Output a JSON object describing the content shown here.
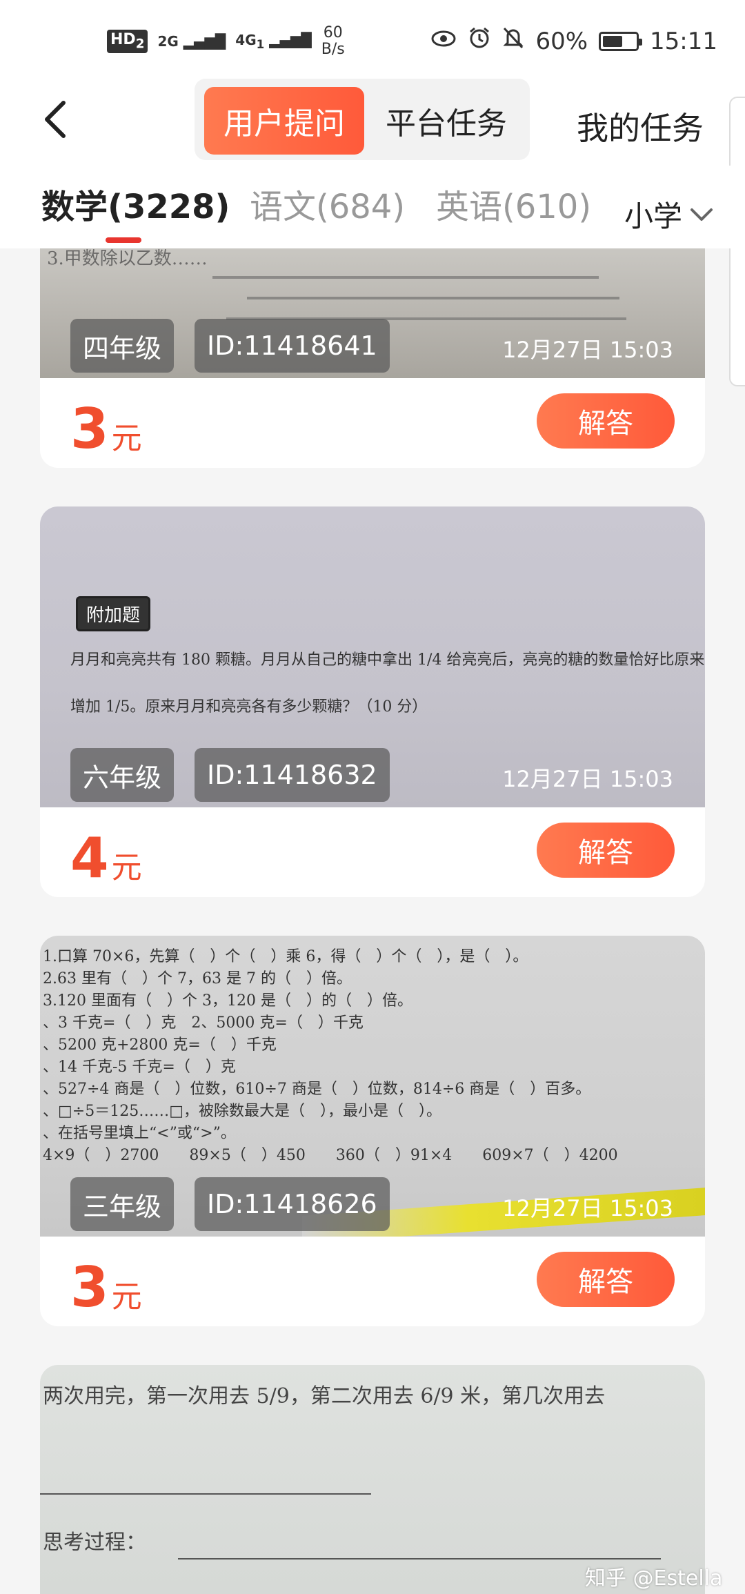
{
  "status_bar": {
    "hd": "HD",
    "hd_sub": "2",
    "sig1": "2G",
    "sig2": "4G",
    "sig2_sub": "1",
    "speed_num": "60",
    "speed_unit": "B/s",
    "battery_pct": "60%",
    "battery_level": 0.6,
    "time": "15:11"
  },
  "header": {
    "tab_user_questions": "用户提问",
    "tab_platform_tasks": "平台任务",
    "my_tasks": "我的任务"
  },
  "subjects": {
    "tabs": [
      {
        "label": "数学(3228)",
        "active": true
      },
      {
        "label": "语文(684)",
        "active": false
      },
      {
        "label": "英语(610)",
        "active": false
      }
    ],
    "level": "小学"
  },
  "cards": [
    {
      "grade": "四年级",
      "id": "ID:11418641",
      "time": "12月27日 15:03",
      "price": "3",
      "unit": "元",
      "button": "解答",
      "image_text": [
        "3.甲数除以乙数……"
      ]
    },
    {
      "grade": "六年级",
      "id": "ID:11418632",
      "time": "12月27日 15:03",
      "price": "4",
      "unit": "元",
      "button": "解答",
      "image_tag": "附加题",
      "image_text": [
        "月月和亮亮共有 180 颗糖。月月从自己的糖中拿出 1/4 给亮亮后，亮亮的糖的数量恰好比原来",
        "增加 1/5。原来月月和亮亮各有多少颗糖？（10 分）"
      ]
    },
    {
      "grade": "三年级",
      "id": "ID:11418626",
      "time": "12月27日 15:03",
      "price": "3",
      "unit": "元",
      "button": "解答",
      "image_text": [
        "1.口算 70×6，先算（　）个（　）乘 6，得（　）个（　），是（　）。",
        "2.63 里有（　）个 7，63 是 7 的（　）倍。",
        "3.120 里面有（　）个 3，120 是（　）的（　）倍。",
        "、3 千克=（　）克　2、5000 克=（　）千克",
        "、5200 克+2800 克=（　）千克",
        "、14 千克-5 千克=（　）克",
        "、527÷4 商是（　）位数，610÷7 商是（　）位数，814÷6 商是（　）百多。",
        "、□÷5＝125……□，被除数最大是（　），最小是（　）。",
        "、在括号里填上“<”或“>”。",
        "4×9（　）2700　　89×5（　）450　　360（　）91×4　　609×7（　）4200"
      ]
    },
    {
      "image_text": [
        "两次用完，第一次用去 5/9，第二次用去 6/9 米，第几次用去",
        "思考过程："
      ]
    }
  ],
  "watermark": "知乎 @Estella"
}
